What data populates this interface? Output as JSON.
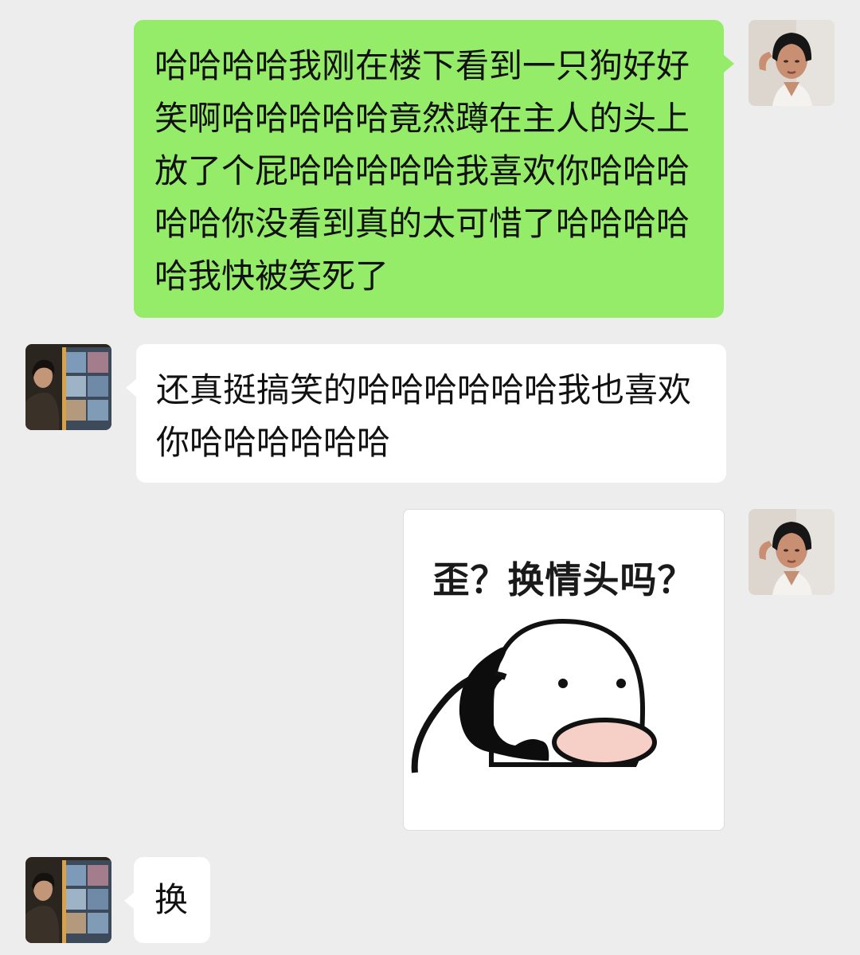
{
  "messages": [
    {
      "sender": "me",
      "text": "哈哈哈哈我刚在楼下看到一只狗好好笑啊哈哈哈哈哈竟然蹲在主人的头上放了个屁哈哈哈哈哈我喜欢你哈哈哈哈哈你没看到真的太可惜了哈哈哈哈哈我快被笑死了"
    },
    {
      "sender": "friend",
      "text": "还真挺搞笑的哈哈哈哈哈哈我也喜欢你哈哈哈哈哈哈"
    },
    {
      "sender": "me",
      "sticker_text": "歪？换情头吗？"
    },
    {
      "sender": "friend",
      "text": "换"
    }
  ],
  "colors": {
    "background": "#ededed",
    "my_bubble": "#95ec69",
    "friend_bubble": "#ffffff"
  }
}
